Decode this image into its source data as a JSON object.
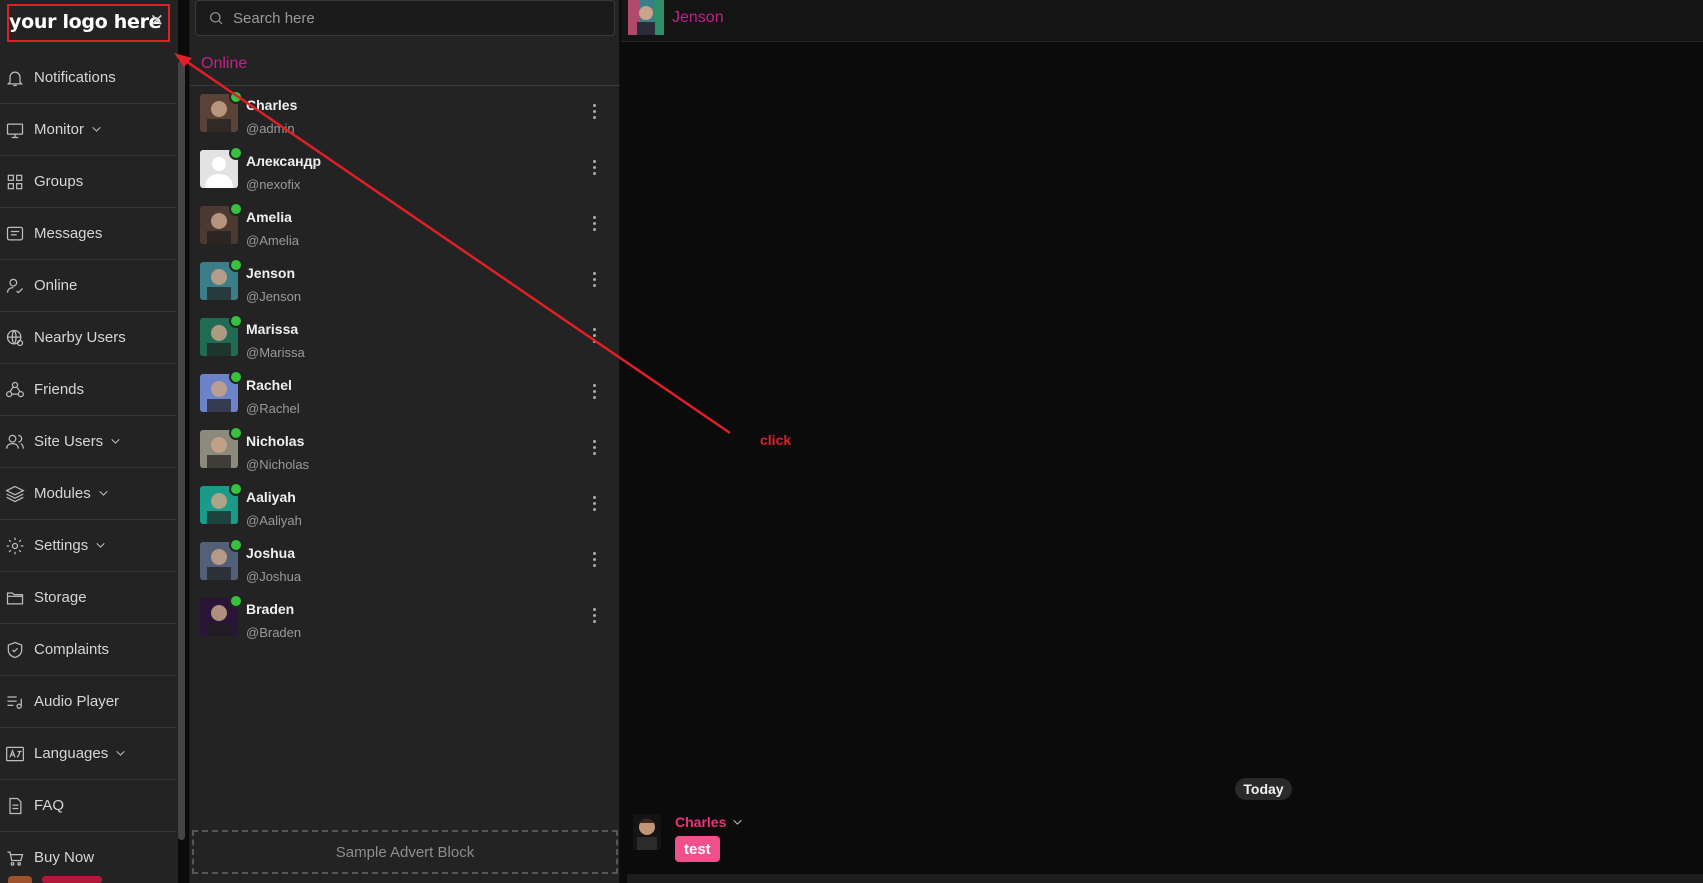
{
  "sidebar": {
    "logo_text": "your logo here",
    "close_glyph": "✕",
    "items": [
      {
        "label": "Notifications",
        "icon": "bell-icon",
        "has_chevron": false
      },
      {
        "label": "Monitor",
        "icon": "monitor-icon",
        "has_chevron": true
      },
      {
        "label": "Groups",
        "icon": "grid-icon",
        "has_chevron": false
      },
      {
        "label": "Messages",
        "icon": "messages-icon",
        "has_chevron": false
      },
      {
        "label": "Online",
        "icon": "user-check-icon",
        "has_chevron": false
      },
      {
        "label": "Nearby Users",
        "icon": "globe-user-icon",
        "has_chevron": false
      },
      {
        "label": "Friends",
        "icon": "friends-icon",
        "has_chevron": false
      },
      {
        "label": "Site Users",
        "icon": "users-icon",
        "has_chevron": true
      },
      {
        "label": "Modules",
        "icon": "layers-icon",
        "has_chevron": true
      },
      {
        "label": "Settings",
        "icon": "gear-icon",
        "has_chevron": true
      },
      {
        "label": "Storage",
        "icon": "folder-icon",
        "has_chevron": false
      },
      {
        "label": "Complaints",
        "icon": "shield-icon",
        "has_chevron": false
      },
      {
        "label": "Audio Player",
        "icon": "playlist-icon",
        "has_chevron": false
      },
      {
        "label": "Languages",
        "icon": "translate-icon",
        "has_chevron": true
      },
      {
        "label": "FAQ",
        "icon": "document-icon",
        "has_chevron": false
      },
      {
        "label": "Buy Now",
        "icon": "cart-icon",
        "has_chevron": false
      }
    ]
  },
  "search": {
    "placeholder": "Search here"
  },
  "user_list": {
    "title": "Online",
    "users": [
      {
        "name": "Charles",
        "handle": "@admin",
        "avatar_color": "#5a4336"
      },
      {
        "name": "Александр",
        "handle": "@nexofix",
        "avatar_color": "#d9d9d9"
      },
      {
        "name": "Amelia",
        "handle": "@Amelia",
        "avatar_color": "#4a3a32"
      },
      {
        "name": "Jenson",
        "handle": "@Jenson",
        "avatar_color": "#3c7d8a"
      },
      {
        "name": "Marissa",
        "handle": "@Marissa",
        "avatar_color": "#1f6b54"
      },
      {
        "name": "Rachel",
        "handle": "@Rachel",
        "avatar_color": "#6c83c9"
      },
      {
        "name": "Nicholas",
        "handle": "@Nicholas",
        "avatar_color": "#8c8a7c"
      },
      {
        "name": "Aaliyah",
        "handle": "@Aaliyah",
        "avatar_color": "#1a9a88"
      },
      {
        "name": "Joshua",
        "handle": "@Joshua",
        "avatar_color": "#52607a"
      },
      {
        "name": "Braden",
        "handle": "@Braden",
        "avatar_color": "#2a1438"
      }
    ]
  },
  "advert": {
    "label": "Sample Advert Block"
  },
  "chat": {
    "header_name": "Jenson",
    "date_divider": "Today",
    "messages": [
      {
        "sender": "Charles",
        "text": "test"
      }
    ]
  },
  "annotation": {
    "label": "click"
  },
  "colors": {
    "accent": "#c2208a",
    "sender": "#f0327a",
    "bubble": "#f0518a",
    "online": "#36c33b",
    "annotation": "#e01f26"
  }
}
